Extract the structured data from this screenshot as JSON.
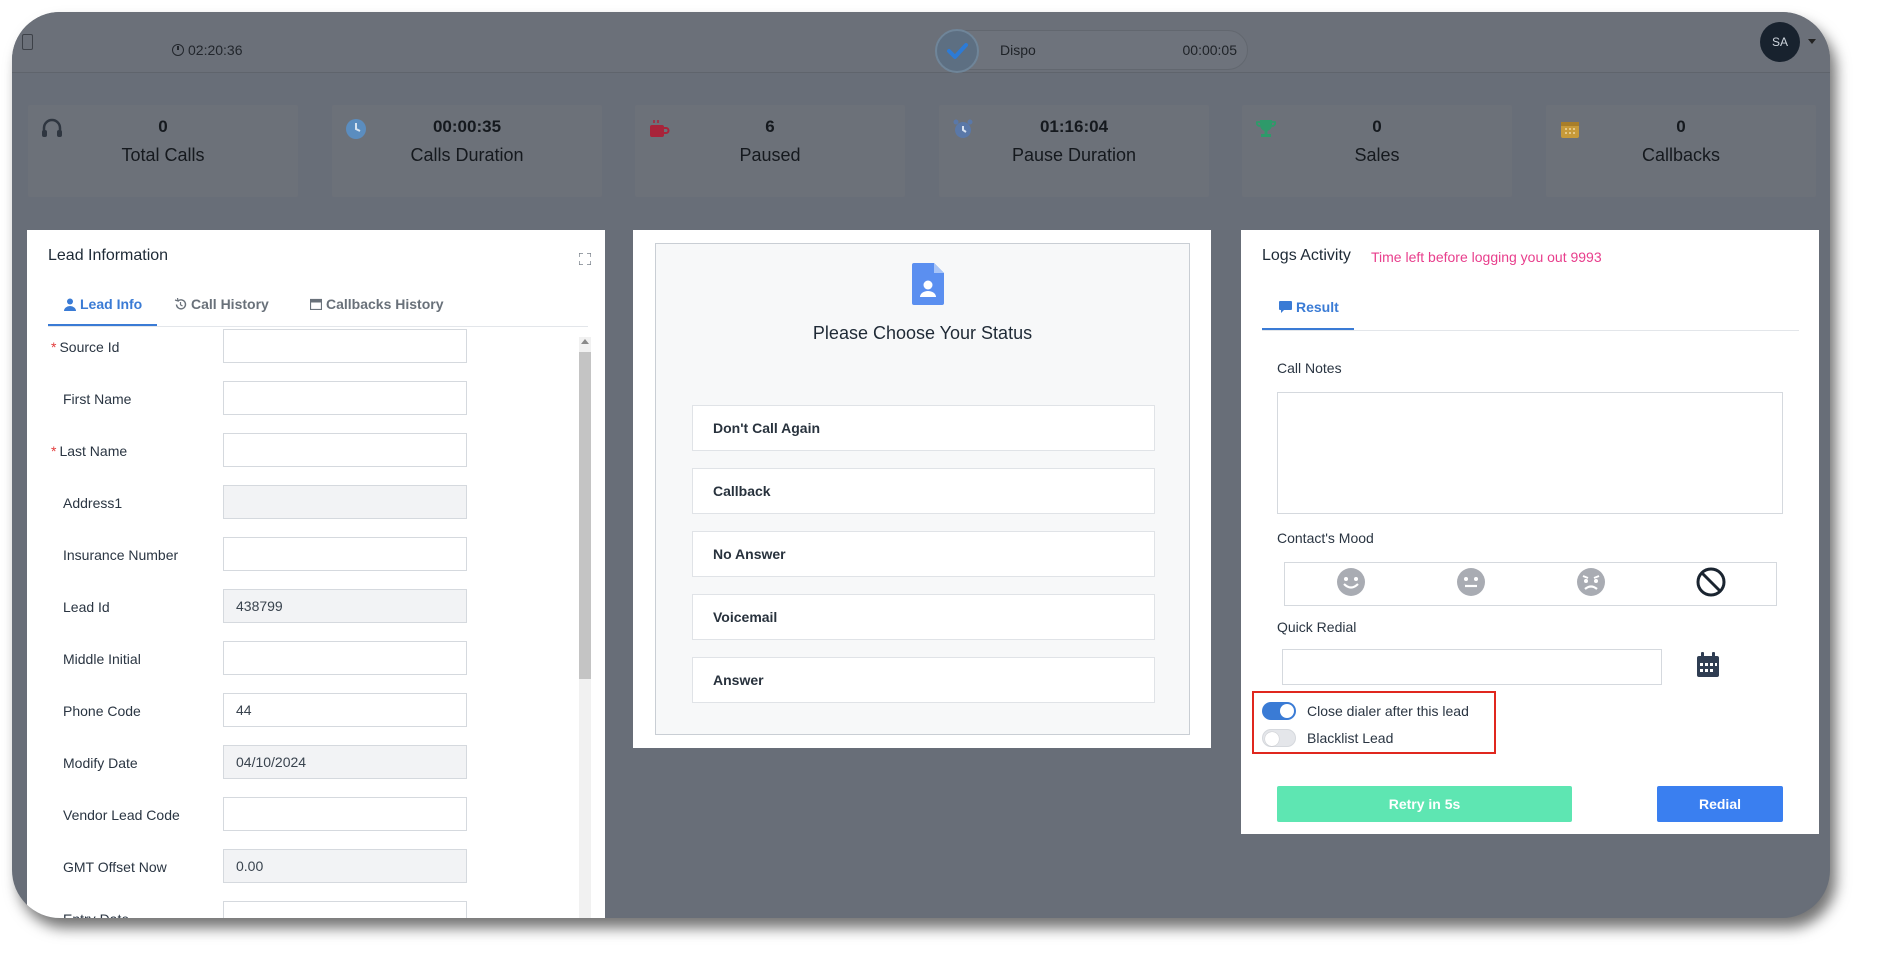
{
  "topbar": {
    "timer": "02:20:36",
    "dispo_label": "Dispo",
    "dispo_duration": "00:00:05",
    "avatar_initials": "SA"
  },
  "stats": [
    {
      "value": "0",
      "label": "Total Calls",
      "icon": "headset-icon",
      "color": "#2f3640"
    },
    {
      "value": "00:00:35",
      "label": "Calls Duration",
      "icon": "clock-icon",
      "color": "#5b8dbf"
    },
    {
      "value": "6",
      "label": "Paused",
      "icon": "coffee-icon",
      "color": "#a8243a"
    },
    {
      "value": "01:16:04",
      "label": "Pause Duration",
      "icon": "alarm-icon",
      "color": "#5a78a8"
    },
    {
      "value": "0",
      "label": "Sales",
      "icon": "trophy-icon",
      "color": "#2e9a6a"
    },
    {
      "value": "0",
      "label": "Callbacks",
      "icon": "calendar-icon",
      "color": "#c79a3a"
    }
  ],
  "lead": {
    "title": "Lead Information",
    "tabs": [
      "Lead Info",
      "Call History",
      "Callbacks History"
    ],
    "fields": [
      {
        "label": "Source Id",
        "value": "",
        "required": true,
        "readonly": false
      },
      {
        "label": "First Name",
        "value": "",
        "required": false,
        "readonly": false
      },
      {
        "label": "Last Name",
        "value": "",
        "required": true,
        "readonly": false
      },
      {
        "label": "Address1",
        "value": "",
        "required": false,
        "readonly": true
      },
      {
        "label": "Insurance Number",
        "value": "",
        "required": false,
        "readonly": false
      },
      {
        "label": "Lead Id",
        "value": "438799",
        "required": false,
        "readonly": true
      },
      {
        "label": "Middle Initial",
        "value": "",
        "required": false,
        "readonly": false
      },
      {
        "label": "Phone Code",
        "value": "44",
        "required": false,
        "readonly": false
      },
      {
        "label": "Modify Date",
        "value": "04/10/2024",
        "required": false,
        "readonly": true
      },
      {
        "label": "Vendor Lead Code",
        "value": "",
        "required": false,
        "readonly": false
      },
      {
        "label": "GMT Offset Now",
        "value": "0.00",
        "required": false,
        "readonly": true
      },
      {
        "label": "Entry Date",
        "value": "",
        "required": false,
        "readonly": false
      }
    ]
  },
  "status": {
    "title": "Please Choose Your Status",
    "options": [
      "Don't Call Again",
      "Callback",
      "No Answer",
      "Voicemail",
      "Answer"
    ]
  },
  "logs": {
    "title": "Logs Activity",
    "warning": "Time left before logging you out 9993",
    "tab": "Result",
    "notes_label": "Call Notes",
    "mood_label": "Contact's Mood",
    "quick_redial_label": "Quick Redial",
    "toggle_close": "Close dialer after this lead",
    "toggle_blacklist": "Blacklist Lead",
    "retry_label": "Retry in 5s",
    "redial_label": "Redial",
    "accent": "#3a7bd5",
    "warning_color": "#e83e8c"
  }
}
